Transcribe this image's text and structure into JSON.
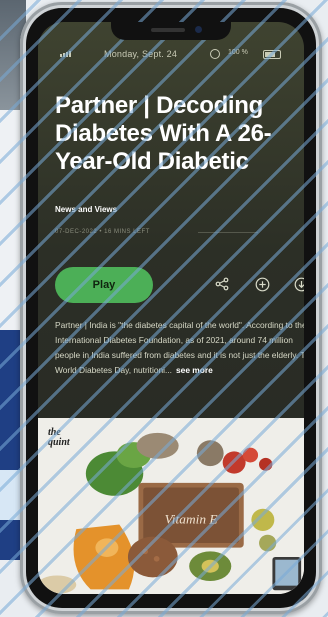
{
  "status_bar": {
    "date": "Monday, Sept. 24",
    "battery_percent": "100 %"
  },
  "article": {
    "title": "Partner | Decoding Diabetes With A 26-Year-Old Diabetic",
    "source": "News and Views",
    "meta": "07-DEC-2022 • 16 MINS LEFT",
    "play_label": "Play",
    "description": "Partner | India is \"the diabetes capital of the world\". According to the International Diabetes Foundation, as of 2021, around 74 million people in India suffered from diabetes and it is not just the elderly. This World Diabetes Day, nutritioni...",
    "see_more_label": "see more"
  },
  "actions": {
    "icons": [
      "share-icon",
      "add-icon",
      "download-icon"
    ]
  },
  "hero_image": {
    "brand_line1": "the",
    "brand_line2": "quint",
    "board_text": "Vitamin E"
  },
  "colors": {
    "play_button": "#4caf57",
    "screen_bg": "#2c2f26"
  }
}
